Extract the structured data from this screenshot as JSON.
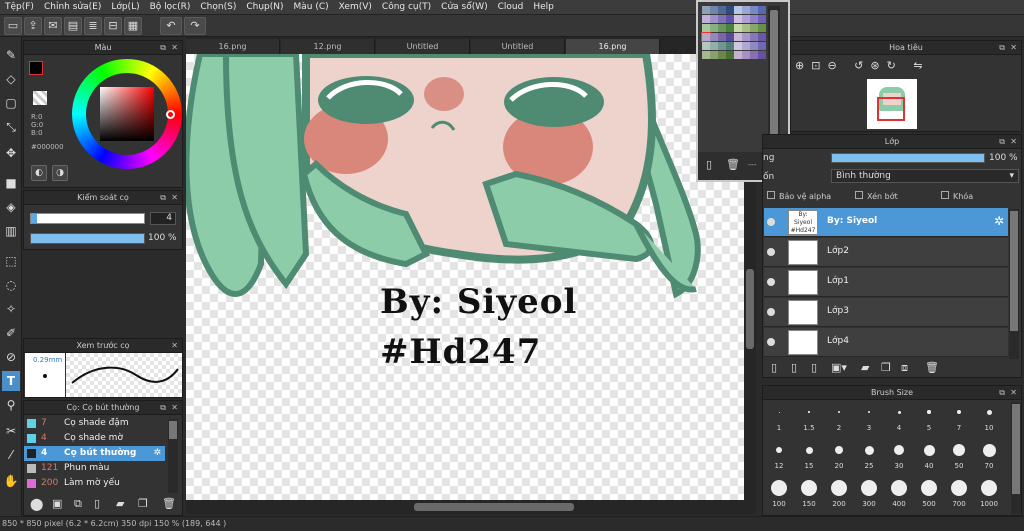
{
  "menu": [
    "Tệp(F)",
    "Chỉnh sửa(E)",
    "Lớp(L)",
    "Bộ lọc(R)",
    "Chọn(S)",
    "Chụp(N)",
    "Màu (C)",
    "Xem(V)",
    "Công cụ(T)",
    "Cửa sổ(W)",
    "Cloud",
    "Help"
  ],
  "tabs": [
    "16.png",
    "12.png",
    "Untitled",
    "Untitled",
    "16.png"
  ],
  "color_panel": {
    "title": "Màu",
    "r": "R:0",
    "g": "G:0",
    "b": "B:0",
    "hex": "#000000"
  },
  "brush_control": {
    "title": "Kiểm soát cọ",
    "size": "4",
    "opacity": "100 %",
    "size_fill": 0.05,
    "opacity_fill": 1.0
  },
  "brush_preview": {
    "title": "Xem trước cọ",
    "size": "0.29mm"
  },
  "brush_list": {
    "title": "Cọ: Cọ bút thường",
    "items": [
      {
        "num": "7",
        "name": "Cọ shade đậm",
        "color": "#5fd0e8"
      },
      {
        "num": "4",
        "name": "Cọ shade mờ",
        "color": "#5fd0e8"
      },
      {
        "num": "4",
        "name": "Cọ bút thường",
        "color": "#222222",
        "selected": true
      },
      {
        "num": "121",
        "name": "Phun màu",
        "color": "#bbbbbb"
      },
      {
        "num": "200",
        "name": "Làm mờ yếu",
        "color": "#e06ad8"
      }
    ]
  },
  "navigator": {
    "title": "Hoa tiêu"
  },
  "layer_panel": {
    "title": "Lớp",
    "opacity_label": "ng",
    "opacity": "100 %",
    "blend": "Bình thường",
    "blend_label": "ốn",
    "protect_alpha": "Bảo vệ alpha",
    "clip": "Xén bớt",
    "lock": "Khóa",
    "layers": [
      {
        "name": "By: Siyeol",
        "thumb": "By: Siyeol #Hd247",
        "selected": true
      },
      {
        "name": "Lớp2",
        "thumb": ""
      },
      {
        "name": "Lớp1",
        "thumb": ""
      },
      {
        "name": "Lớp3",
        "thumb": ""
      },
      {
        "name": "Lớp4",
        "thumb": ""
      }
    ]
  },
  "brush_size": {
    "title": "Brush Size",
    "sizes": [
      "1",
      "1.5",
      "2",
      "3",
      "4",
      "5",
      "7",
      "10",
      "12",
      "15",
      "20",
      "25",
      "30",
      "40",
      "50",
      "70",
      "100",
      "150",
      "200",
      "300",
      "400",
      "500",
      "700",
      "1000"
    ]
  },
  "palette_popup": {
    "label": "---"
  },
  "canvas_text": {
    "line1": "By: Siyeol",
    "line2": "#Hd247"
  },
  "status": {
    "text": "850 * 850 pixel  (6.2 * 6.2cm)  350 dpi  150 %  (189, 644 )"
  },
  "colors": {
    "accent": "#4c97d6",
    "hair": "#8dcca8",
    "hair_outline": "#4f8a72",
    "skin": "#eed3cd",
    "blush": "#d9877a",
    "nose": "#d98f84"
  }
}
